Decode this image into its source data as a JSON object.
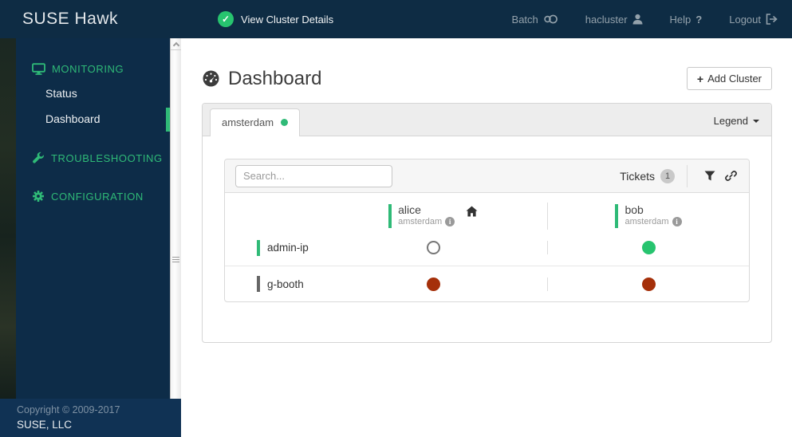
{
  "navbar": {
    "brand": "SUSE Hawk",
    "cluster_status_label": "View Cluster Details",
    "links": [
      {
        "label": "Batch",
        "icon": "batch-toggle-icon"
      },
      {
        "label": "hacluster",
        "icon": "user-icon"
      },
      {
        "label": "Help",
        "icon": "question-icon",
        "icon_glyph": "?"
      },
      {
        "label": "Logout",
        "icon": "logout-icon"
      }
    ]
  },
  "sidebar": {
    "sections": [
      {
        "label": "MONITORING",
        "icon": "monitor-icon",
        "items": [
          {
            "label": "Status",
            "active": false
          },
          {
            "label": "Dashboard",
            "active": true
          }
        ]
      },
      {
        "label": "TROUBLESHOOTING",
        "icon": "wrench-icon",
        "items": []
      },
      {
        "label": "CONFIGURATION",
        "icon": "gear-icon",
        "items": []
      }
    ],
    "footer": {
      "copyright": "Copyright © 2009-2017",
      "company": "SUSE, LLC"
    }
  },
  "main": {
    "title": "Dashboard",
    "add_cluster_label": "Add Cluster",
    "add_cluster_plus": "+",
    "tabs": [
      {
        "label": "amsterdam",
        "status": "online",
        "status_color": "#2fba77"
      }
    ],
    "legend_label": "Legend",
    "toolbar": {
      "search_placeholder": "Search...",
      "tickets_label": "Tickets",
      "tickets_count": "1"
    },
    "grid": {
      "columns": [
        {
          "name": "alice",
          "cluster": "amsterdam",
          "dc": true
        },
        {
          "name": "bob",
          "cluster": "amsterdam",
          "dc": false
        }
      ],
      "rows": [
        {
          "label": "admin-ip",
          "bar_color": "#2fba77",
          "statuses": {
            "alice": "not-running",
            "bob": "running"
          }
        },
        {
          "label": "g-booth",
          "bar_color": "#666666",
          "statuses": {
            "alice": "failed",
            "bob": "failed"
          }
        }
      ]
    }
  },
  "colors": {
    "navy": "#0e2c44",
    "sidebar_navy": "#0d2c48",
    "footer_navy": "#103254",
    "accent_green": "#2fba77",
    "status_green": "#27c46f",
    "status_red": "#a5300a",
    "panel_border": "#d5d5d5"
  }
}
